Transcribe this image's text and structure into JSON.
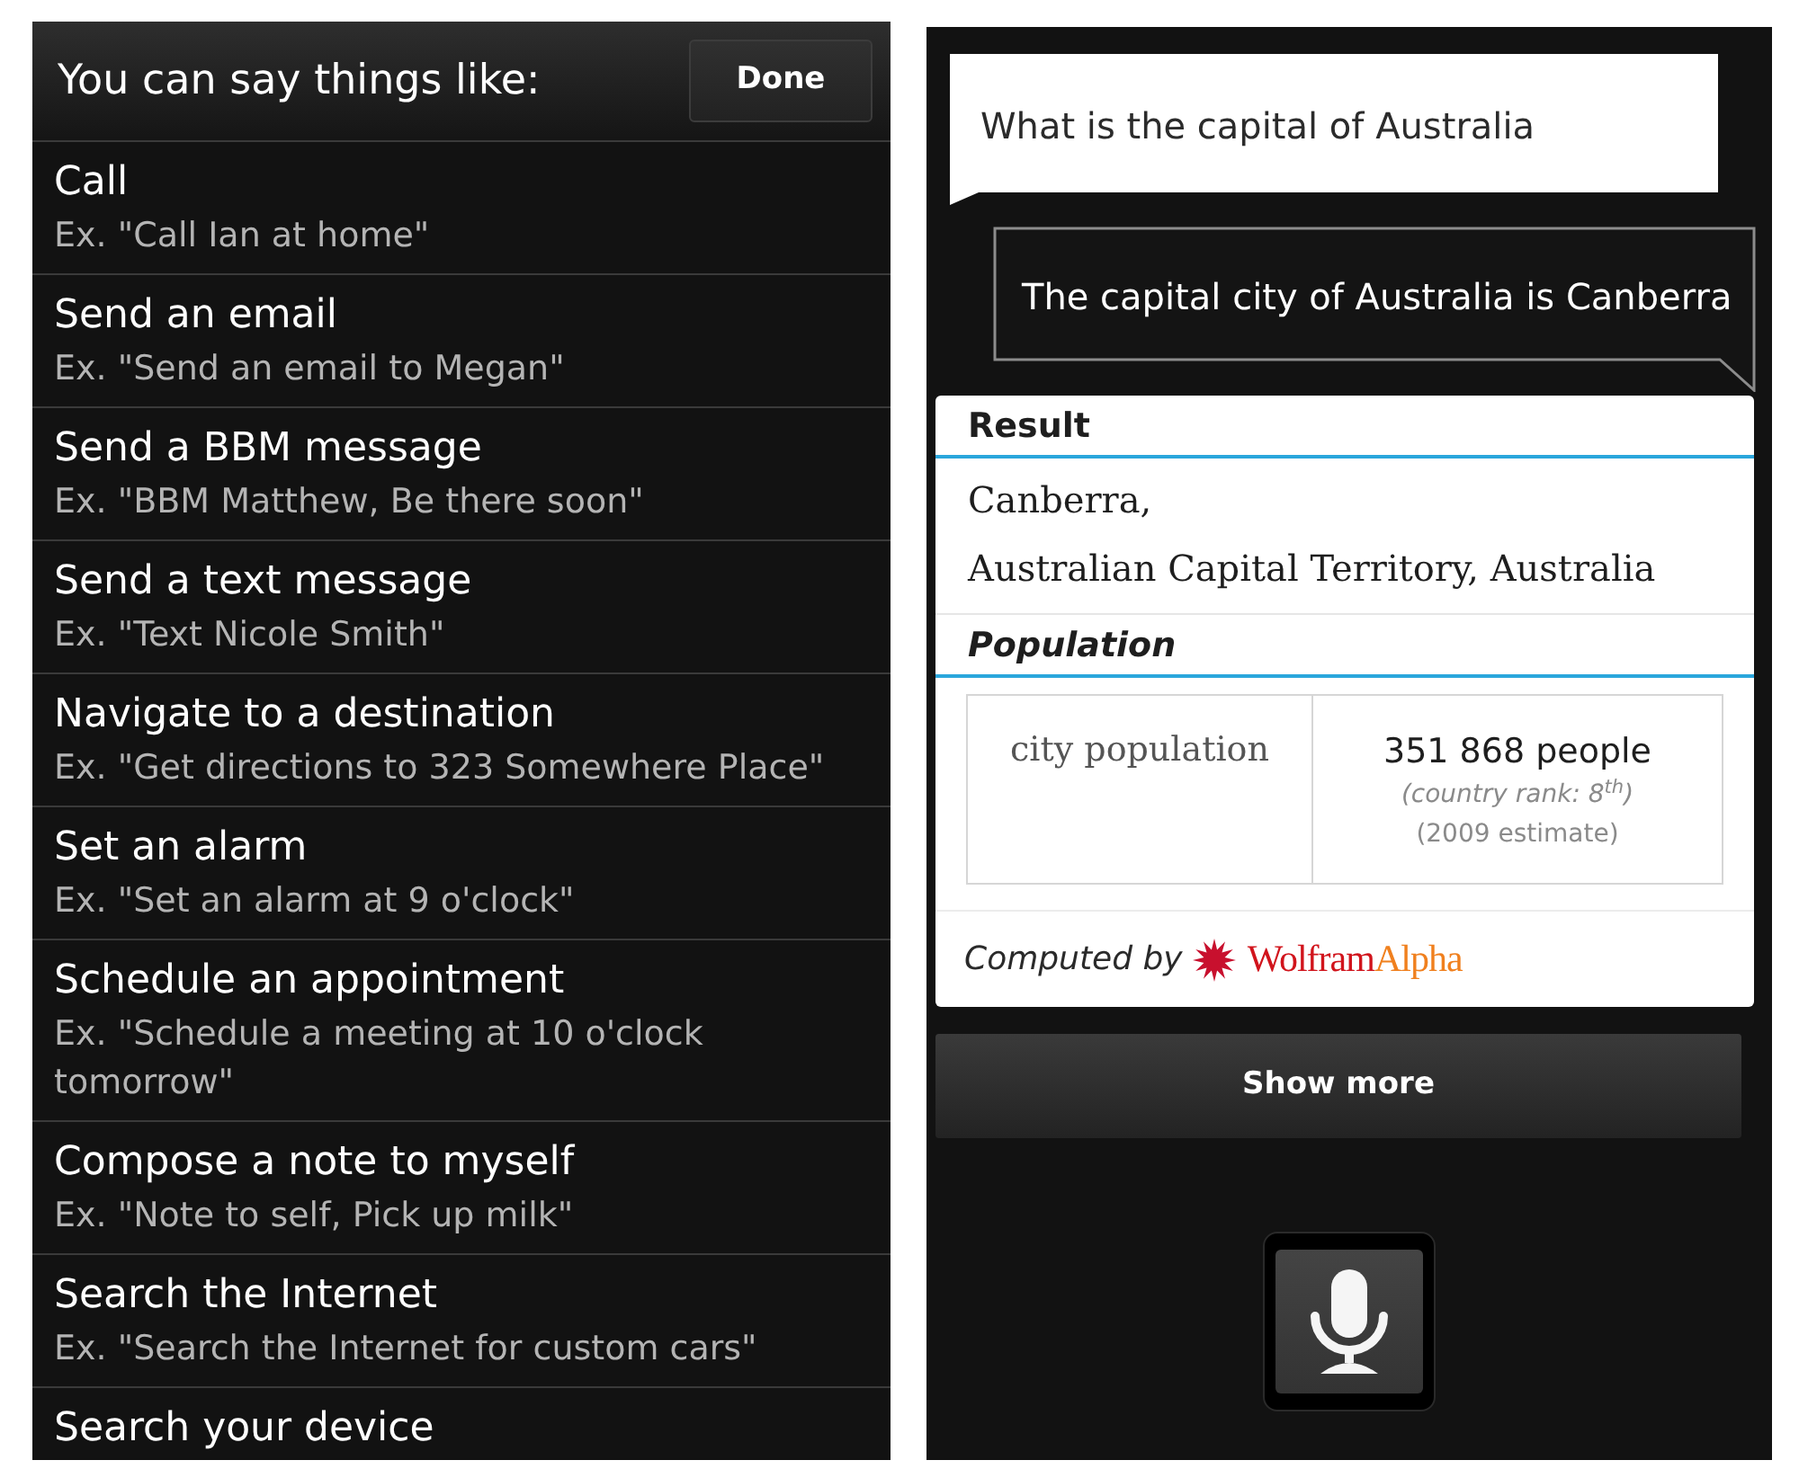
{
  "hints_panel": {
    "title": "You can say things like:",
    "done_button": "Done",
    "items": [
      {
        "command": "Call",
        "example": "Ex. \"Call Ian at home\""
      },
      {
        "command": "Send an email",
        "example": "Ex. \"Send an email to Megan\""
      },
      {
        "command": "Send a BBM message",
        "example": "Ex. \"BBM Matthew, Be there soon\""
      },
      {
        "command": "Send a text message",
        "example": "Ex. \"Text Nicole Smith\""
      },
      {
        "command": "Navigate to a destination",
        "example": "Ex. \"Get directions to 323 Somewhere Place\""
      },
      {
        "command": "Set an alarm",
        "example": "Ex. \"Set an alarm at 9 o'clock\""
      },
      {
        "command": "Schedule an appointment",
        "example": "Ex. \"Schedule a meeting at 10 o'clock tomorrow\""
      },
      {
        "command": "Compose a note to myself",
        "example": "Ex. \"Note to self, Pick up milk\""
      },
      {
        "command": "Search the Internet",
        "example": "Ex. \"Search the Internet for custom cars\""
      },
      {
        "command": "Search your device"
      }
    ]
  },
  "conversation": {
    "question": "What is the capital of Australia",
    "answer": "The capital city of Australia is Canberra"
  },
  "result_card": {
    "sections": [
      {
        "kind": "text",
        "heading": "Result",
        "italic": false,
        "lines": [
          "Canberra,",
          "Australian Capital Territory, Australia"
        ]
      },
      {
        "kind": "table",
        "heading": "Population",
        "italic": true,
        "rows": [
          {
            "label": "city population",
            "value": "351 868 people",
            "notes": [
              "(country rank: 8$^{th}$)",
              "(2009 estimate)"
            ]
          }
        ]
      }
    ],
    "footer": "Computed by",
    "logo": [
      "Wolfram",
      "Alpha"
    ]
  },
  "show_more_button": "Show more"
}
